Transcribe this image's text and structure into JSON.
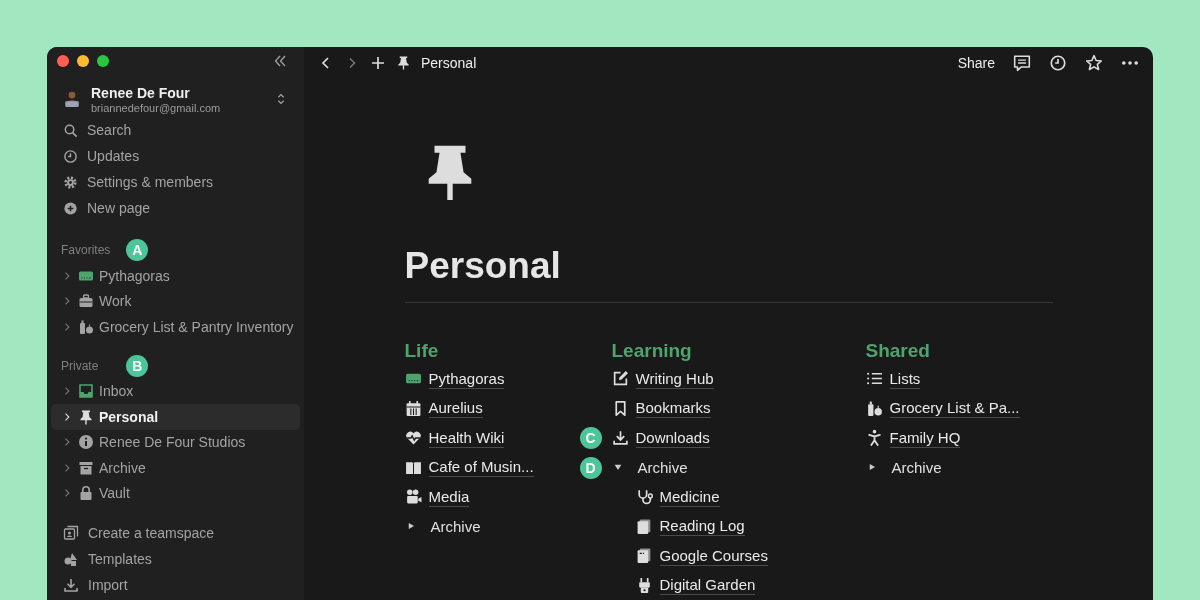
{
  "sidebar": {
    "account": {
      "name": "Renee De Four",
      "email": "briannedefour@gmail.com"
    },
    "nav": [
      {
        "label": "Search"
      },
      {
        "label": "Updates"
      },
      {
        "label": "Settings & members"
      },
      {
        "label": "New page"
      }
    ],
    "favorites": {
      "title": "Favorites",
      "marker": "A",
      "items": [
        {
          "label": "Pythagoras",
          "selected": false
        },
        {
          "label": "Work",
          "selected": false
        },
        {
          "label": "Grocery List & Pantry Inventory",
          "selected": false
        }
      ]
    },
    "private": {
      "title": "Private",
      "marker": "B",
      "items": [
        {
          "label": "Inbox",
          "selected": false
        },
        {
          "label": "Personal",
          "selected": true
        },
        {
          "label": "Renee De Four Studios",
          "selected": false
        },
        {
          "label": "Archive",
          "selected": false
        },
        {
          "label": "Vault",
          "selected": false
        }
      ]
    },
    "bottom": [
      {
        "label": "Create a teamspace"
      },
      {
        "label": "Templates"
      },
      {
        "label": "Import"
      }
    ]
  },
  "topbar": {
    "breadcrumb": "Personal",
    "share": "Share"
  },
  "page": {
    "title": "Personal",
    "columns": [
      {
        "heading": "Life",
        "items": [
          {
            "kind": "page",
            "label": "Pythagoras"
          },
          {
            "kind": "page",
            "label": "Aurelius"
          },
          {
            "kind": "page",
            "label": "Health Wiki"
          },
          {
            "kind": "page",
            "label": "Cafe of Musin..."
          },
          {
            "kind": "page",
            "label": "Media"
          },
          {
            "kind": "toggle",
            "label": "Archive",
            "expanded": false
          }
        ]
      },
      {
        "heading": "Learning",
        "items": [
          {
            "kind": "page",
            "label": "Writing Hub"
          },
          {
            "kind": "page",
            "label": "Bookmarks"
          },
          {
            "kind": "page",
            "label": "Downloads",
            "marker": "C"
          },
          {
            "kind": "toggle",
            "label": "Archive",
            "expanded": true,
            "marker": "D",
            "children": [
              {
                "kind": "page",
                "label": "Medicine"
              },
              {
                "kind": "page",
                "label": "Reading Log"
              },
              {
                "kind": "page",
                "label": "Google Courses"
              },
              {
                "kind": "page",
                "label": "Digital Garden"
              }
            ]
          }
        ]
      },
      {
        "heading": "Shared",
        "items": [
          {
            "kind": "page",
            "label": "Lists"
          },
          {
            "kind": "page",
            "label": "Grocery List & Pa..."
          },
          {
            "kind": "page",
            "label": "Family HQ"
          },
          {
            "kind": "toggle",
            "label": "Archive",
            "expanded": false
          }
        ]
      }
    ]
  }
}
